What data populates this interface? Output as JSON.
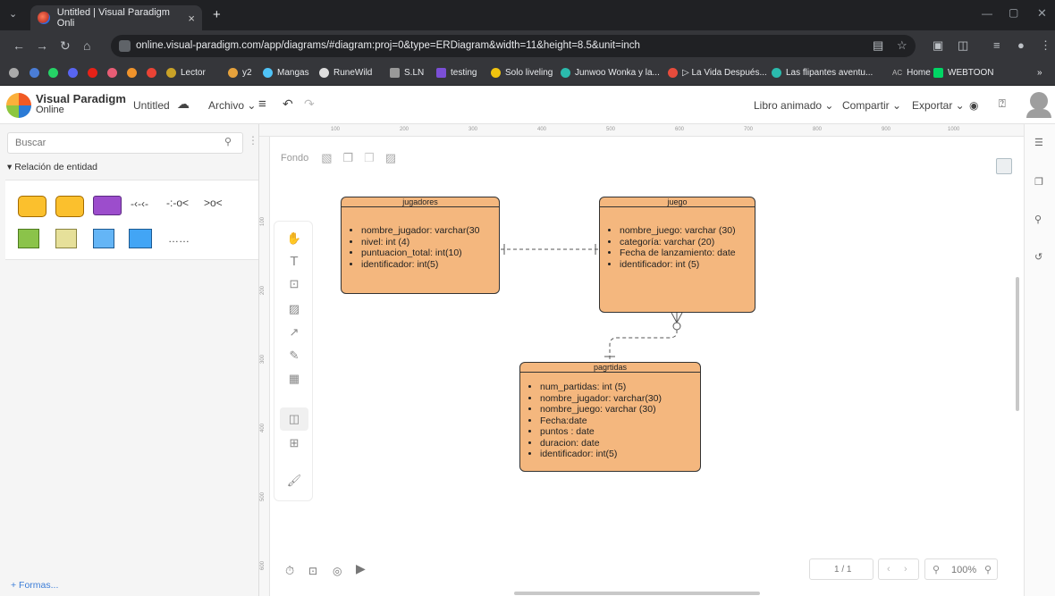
{
  "browser": {
    "tab_title": "Untitled | Visual Paradigm Onli",
    "tab_close": "×",
    "new_tab": "+",
    "url": "online.visual-paradigm.com/app/diagrams/#diagram:proj=0&type=ERDiagram&width=11&height=8.5&unit=inch",
    "bookmarks": [
      "Lector",
      "y2",
      "Mangas",
      "RuneWild",
      "S.LN",
      "testing",
      "Solo liveling",
      "Junwoo Wonka y la...",
      "▷ La Vida Después...",
      "Las flipantes aventu...",
      "Home",
      "WEBTOON"
    ]
  },
  "header": {
    "brand_line1": "Visual Paradigm",
    "brand_line2": "Online",
    "doc_title": "Untitled",
    "menu_archivo": "Archivo ⌄",
    "libro": "Libro animado ⌄",
    "compartir": "Compartir ⌄",
    "exportar": "Exportar ⌄"
  },
  "left": {
    "search_placeholder": "Buscar",
    "section": "▾ Relación de entidad",
    "formas": "+ Formas..."
  },
  "canvas": {
    "fondo": "Fondo",
    "ruler_top": [
      "100",
      "200",
      "300",
      "400",
      "500",
      "600",
      "700",
      "800",
      "900",
      "1000"
    ],
    "ruler_left": [
      "100",
      "200",
      "300",
      "400",
      "500",
      "600"
    ]
  },
  "entities": {
    "jugadores": {
      "title": "jugadores",
      "fields": [
        "nombre_jugador: varchar(30",
        "nivel: int (4)",
        "puntuacion_total: int(10)",
        "identificador: int(5)"
      ]
    },
    "juego": {
      "title": "juego",
      "fields": [
        "nombre_juego: varchar (30)",
        "categoría: varchar (20)",
        "Fecha de lanzamiento: date",
        "identificador: int (5)"
      ]
    },
    "pagrtidas": {
      "title": "pagrtidas",
      "fields": [
        "num_partidas: int (5)",
        "nombre_jugador: varchar(30)",
        "nombre_juego: varchar (30)",
        "Fecha:date",
        "puntos : date",
        "duracion: date",
        "identificador: int(5)"
      ]
    }
  },
  "footer": {
    "page": "1 / 1",
    "zoom": "100%"
  },
  "colors": {
    "entity_fill": "#f4b77e",
    "accent": "#3b7dd8"
  }
}
